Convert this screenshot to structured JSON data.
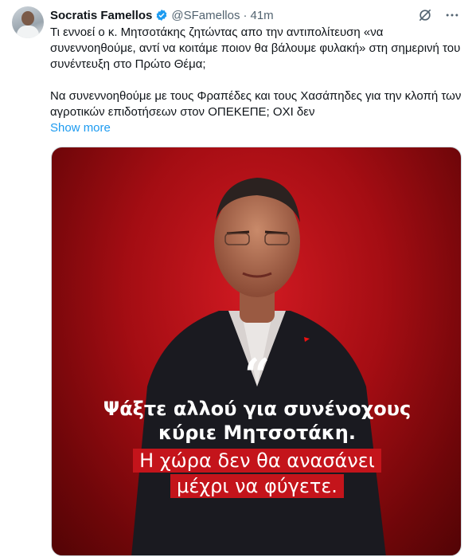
{
  "tweet": {
    "author_name": "Socratis Famellos",
    "handle": "@SFamellos",
    "separator": "·",
    "time": "41m",
    "paragraph1": "Τι εννοεί ο κ. Μητσοτάκης ζητώντας απο την αντιπολίτευση «να συνεννοηθούμε, αντί να κοιτάμε ποιον θα βάλουμε φυλακή» στη σημερινή του συνέντευξη στο Πρώτο Θέμα;",
    "paragraph2": "Να συνεννοηθούμε με τους Φραπέδες και τους Χασάπηδες για την κλοπή των αγροτικών επιδοτήσεων στον ΟΠΕΚΕΠΕ; ΟΧΙ δεν",
    "show_more": "Show more",
    "verified_color": "#1d9bf0"
  },
  "media": {
    "quote_mark": "“",
    "line1": "Ψάξτε αλλού για συνένοχους",
    "line2": "κύριε Μητσοτάκη.",
    "highlight1": "Η χώρα δεν θα ανασάνει",
    "highlight2": "μέχρι να φύγετε.",
    "background_color": "#a40d13",
    "highlight_color": "#c4141b"
  },
  "icons": [
    "grok-icon",
    "more-icon",
    "verified-badge-icon"
  ]
}
